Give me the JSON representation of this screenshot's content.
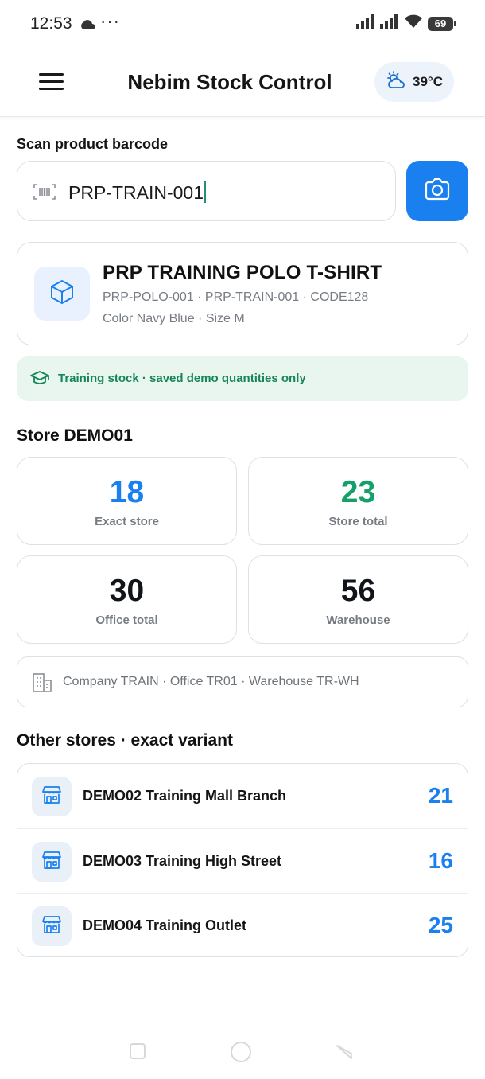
{
  "status_bar": {
    "time": "12:53",
    "more": "···",
    "battery": "69"
  },
  "app_bar": {
    "title": "Nebim Stock Control",
    "weather_temp": "39°C"
  },
  "scan": {
    "label": "Scan product barcode",
    "value": "PRP-TRAIN-001"
  },
  "product": {
    "name": "PRP TRAINING POLO T-SHIRT",
    "codes": "PRP-POLO-001 · PRP-TRAIN-001 · CODE128",
    "variant": "Color Navy Blue · Size M"
  },
  "notice": "Training stock · saved demo quantities only",
  "store": {
    "title": "Store DEMO01",
    "stats": [
      {
        "value": "18",
        "label": "Exact store",
        "color": "#1a80f0"
      },
      {
        "value": "23",
        "label": "Store total",
        "color": "#14a06a"
      },
      {
        "value": "30",
        "label": "Office total",
        "color": "#111418"
      },
      {
        "value": "56",
        "label": "Warehouse",
        "color": "#111418"
      }
    ],
    "org_line": "Company TRAIN · Office TR01 · Warehouse TR-WH"
  },
  "other_stores": {
    "title": "Other stores · exact variant",
    "items": [
      {
        "name": "DEMO02 Training Mall Branch",
        "qty": "21"
      },
      {
        "name": "DEMO03 Training High Street",
        "qty": "16"
      },
      {
        "name": "DEMO04 Training Outlet",
        "qty": "25"
      }
    ]
  },
  "colors": {
    "accent": "#1a80f0",
    "success": "#14a06a",
    "notice_bg": "#e8f6ef"
  }
}
